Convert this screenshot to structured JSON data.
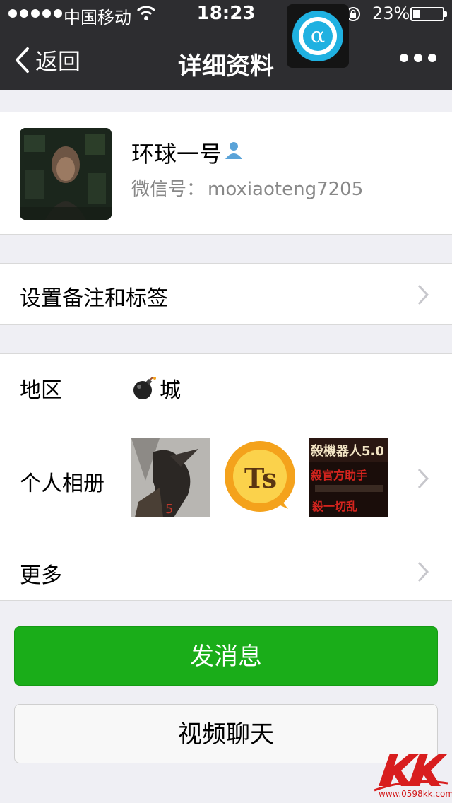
{
  "status_bar": {
    "carrier": "中国移动",
    "time": "18:23",
    "battery": "23%",
    "battery_level": 0.23
  },
  "nav": {
    "back_label": "返回",
    "title": "详细资料",
    "app_badge_glyph": "α"
  },
  "profile": {
    "nickname": "环球一号",
    "wechat_id_label": "微信号：",
    "wechat_id": "moxiaoteng7205"
  },
  "remark_row": {
    "label": "设置备注和标签"
  },
  "region": {
    "label": "地区",
    "value": "城"
  },
  "album": {
    "label": "个人相册",
    "thumb_texts": [
      "5",
      "Ts",
      "殺機器人5.0",
      "殺官方助手",
      "殺一切乱"
    ]
  },
  "more": {
    "label": "更多"
  },
  "buttons": {
    "send_message": "发消息",
    "video_chat": "视频聊天"
  },
  "watermark": {
    "text": "www.0598kk.com"
  },
  "colors": {
    "nav_bg": "#2d2d30",
    "page_bg": "#efeff4",
    "primary_green": "#1aad19",
    "contact_icon": "#5aa3d8"
  }
}
